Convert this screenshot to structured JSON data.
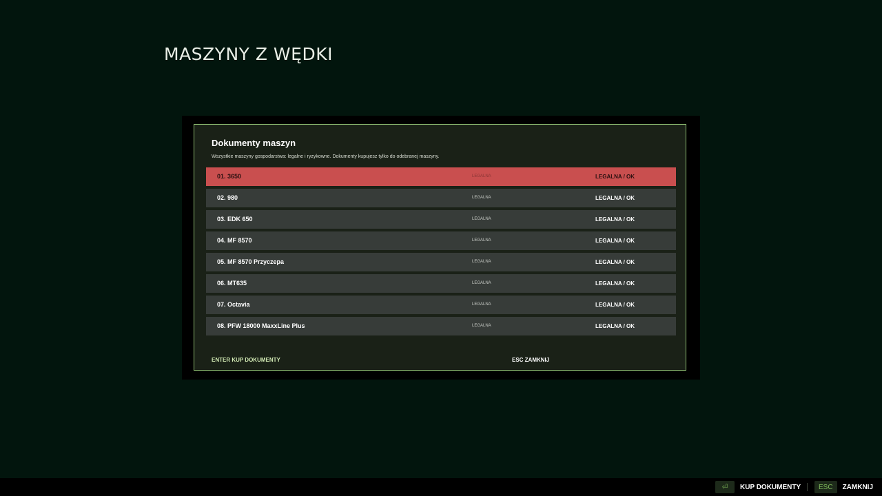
{
  "page": {
    "title": "MASZYNY Z WĘDKI"
  },
  "dialog": {
    "title": "Dokumenty maszyn",
    "subtitle": "Wszystkie maszyny gospodarstwa: legalne i ryzykowne. Dokumenty kupujesz tylko do odebranej maszyny.",
    "selected_index": 0,
    "machines": [
      {
        "name": "01. 3650",
        "status": "LEGALNA",
        "documents": "LEGALNA / OK"
      },
      {
        "name": "02. 980",
        "status": "LEGALNA",
        "documents": "LEGALNA / OK"
      },
      {
        "name": "03. EDK 650",
        "status": "LEGALNA",
        "documents": "LEGALNA / OK"
      },
      {
        "name": "04. MF 8570",
        "status": "LEGALNA",
        "documents": "LEGALNA / OK"
      },
      {
        "name": "05. MF 8570 Przyczepa",
        "status": "LEGALNA",
        "documents": "LEGALNA / OK"
      },
      {
        "name": "06. MT635",
        "status": "LEGALNA",
        "documents": "LEGALNA / OK"
      },
      {
        "name": "07. Octavia",
        "status": "LEGALNA",
        "documents": "LEGALNA / OK"
      },
      {
        "name": "08. PFW 18000 MaxxLine Plus",
        "status": "LEGALNA",
        "documents": "LEGALNA / OK"
      }
    ],
    "action_buy": "ENTER KUP DOKUMENTY",
    "action_close": "ESC ZAMKNIJ"
  },
  "bottom_bar": {
    "buy_key_icon": "enter-key-icon",
    "buy_key_glyph": "⏎",
    "buy_label": "KUP DOKUMENTY",
    "close_key": "ESC",
    "close_label": "ZAMKNIJ"
  },
  "colors": {
    "background": "#02150d",
    "selected_row": "#c94f4f",
    "row": "#373c39",
    "dialog_border": "#8fbf73",
    "accent_text": "#d4ecb6"
  }
}
